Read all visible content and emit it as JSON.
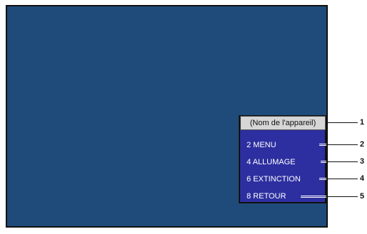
{
  "menu": {
    "device_name": "(Nom de l'appareil)",
    "items": [
      {
        "label": "2 MENU"
      },
      {
        "label": "4 ALLUMAGE"
      },
      {
        "label": "6 EXTINCTION"
      },
      {
        "label": "8 RETOUR"
      }
    ]
  },
  "callouts": [
    "1",
    "2",
    "3",
    "4",
    "5"
  ],
  "colors": {
    "screen_background": "#1f4b7a",
    "menu_background": "#2d2fa0",
    "device_name_background": "#d6d6d6"
  }
}
